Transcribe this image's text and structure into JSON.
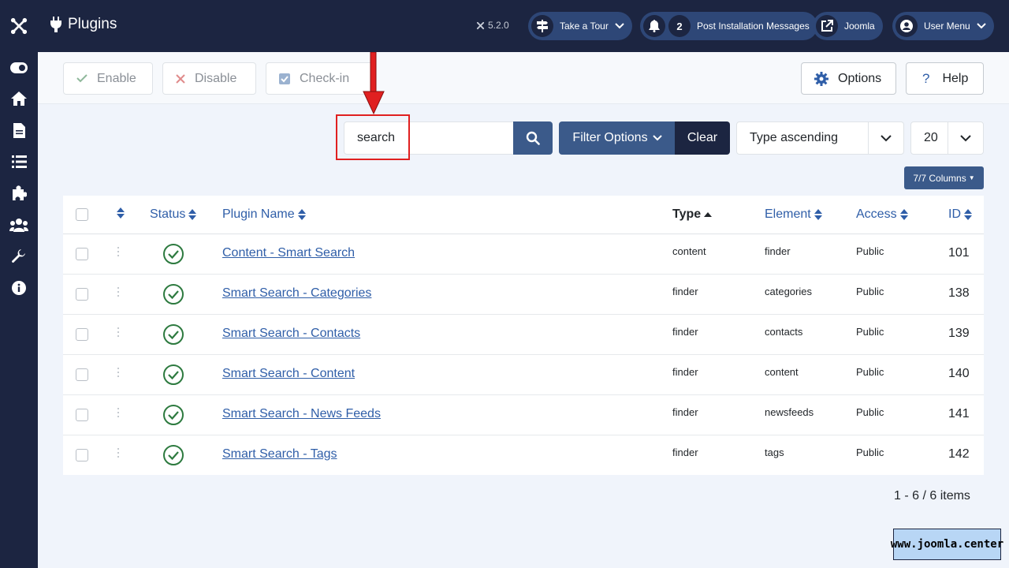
{
  "header": {
    "title": "Plugins",
    "version": "5.2.0",
    "take_tour": "Take a Tour",
    "post_install_count": "2",
    "post_install_label": "Post Installation Messages",
    "joomla_label": "Joomla",
    "user_menu": "User Menu"
  },
  "sidebar": {
    "items": [
      "toggle-menu-icon",
      "home-icon",
      "file-icon",
      "list-icon",
      "puzzle-icon",
      "users-icon",
      "wrench-icon",
      "info-icon"
    ]
  },
  "toolbar": {
    "enable": "Enable",
    "disable": "Disable",
    "checkin": "Check-in",
    "options": "Options",
    "help": "Help"
  },
  "search": {
    "value": "search",
    "filter_options": "Filter Options",
    "clear": "Clear",
    "ordering": "Type ascending",
    "limit": "20",
    "columns": "7/7 Columns"
  },
  "table": {
    "headers": {
      "status": "Status",
      "name": "Plugin Name",
      "type": "Type",
      "element": "Element",
      "access": "Access",
      "id": "ID"
    },
    "rows": [
      {
        "name": "Content - Smart Search",
        "type": "content",
        "element": "finder",
        "access": "Public",
        "id": "101"
      },
      {
        "name": "Smart Search - Categories",
        "type": "finder",
        "element": "categories",
        "access": "Public",
        "id": "138"
      },
      {
        "name": "Smart Search - Contacts",
        "type": "finder",
        "element": "contacts",
        "access": "Public",
        "id": "139"
      },
      {
        "name": "Smart Search - Content",
        "type": "finder",
        "element": "content",
        "access": "Public",
        "id": "140"
      },
      {
        "name": "Smart Search - News Feeds",
        "type": "finder",
        "element": "newsfeeds",
        "access": "Public",
        "id": "141"
      },
      {
        "name": "Smart Search - Tags",
        "type": "finder",
        "element": "tags",
        "access": "Public",
        "id": "142"
      }
    ]
  },
  "pagination": "1 - 6 / 6 items",
  "watermark": "www.joomla.center",
  "colors": {
    "dark_navy": "#1c2541",
    "accent_blue": "#3b5a8a",
    "link_blue": "#2f5ea8",
    "success_green": "#2d7a3f",
    "annotation_red": "#e02020"
  }
}
